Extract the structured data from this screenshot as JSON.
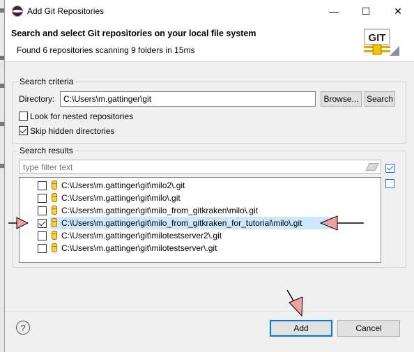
{
  "window": {
    "title": "Add Git Repositories",
    "minimize_glyph": "—",
    "maximize_glyph": "☐",
    "close_glyph": "✕"
  },
  "header": {
    "title": "Search and select Git repositories on your local file system",
    "message": "Found 6 repositories scanning 9 folders in 15ms",
    "logo_text": "GIT"
  },
  "search_criteria": {
    "legend": "Search criteria",
    "directory_label": "Directory:",
    "directory_value": "C:\\Users\\m.gattinger\\git",
    "browse_label": "Browse...",
    "search_label": "Search",
    "nested_label": "Look for nested repositories",
    "nested_checked": false,
    "skip_hidden_label": "Skip hidden directories",
    "skip_hidden_checked": true
  },
  "search_results": {
    "legend": "Search results",
    "filter_placeholder": "type filter text",
    "repositories": [
      {
        "path": "C:\\Users\\m.gattinger\\git\\milo2\\.git",
        "checked": false
      },
      {
        "path": "C:\\Users\\m.gattinger\\git\\milo\\.git",
        "checked": false
      },
      {
        "path": "C:\\Users\\m.gattinger\\git\\milo_from_gitkraken\\milo\\.git",
        "checked": false
      },
      {
        "path": "C:\\Users\\m.gattinger\\git\\milo_from_gitkraken_for_tutorial\\milo\\.git",
        "checked": true
      },
      {
        "path": "C:\\Users\\m.gattinger\\git\\milotestserver2\\.git",
        "checked": false
      },
      {
        "path": "C:\\Users\\m.gattinger\\git\\milotestserver\\.git",
        "checked": false
      }
    ]
  },
  "footer": {
    "help_glyph": "?",
    "add_label": "Add",
    "cancel_label": "Cancel"
  },
  "colors": {
    "selection": "#cce8ff",
    "default_button_border": "#0078d7",
    "annotation_arrow_fill": "#f0a0a0"
  }
}
